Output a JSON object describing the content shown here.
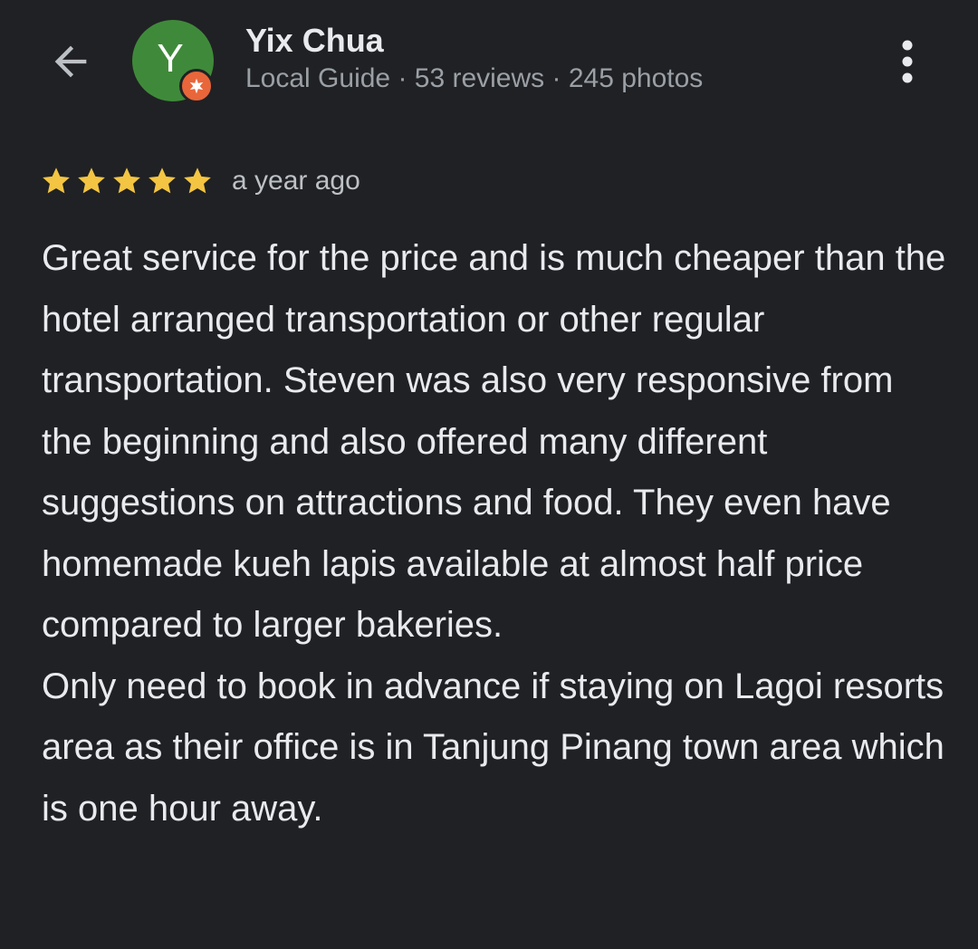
{
  "header": {
    "back_icon": "arrow-left-icon",
    "avatar_letter": "Y",
    "avatar_color": "#3f8a3a",
    "badge_icon": "local-guide-star-icon",
    "badge_color": "#e8663a",
    "user_name": "Yix Chua",
    "user_meta": "Local Guide · 53 reviews · 245 photos",
    "more_icon": "more-vert-icon"
  },
  "review": {
    "rating": 5,
    "max_rating": 5,
    "star_color": "#f4c542",
    "time_ago": "a year ago",
    "text": "Great service for the price and is much cheaper than the hotel arranged transportation or other regular transportation. Steven was also very responsive from the beginning and also offered many different suggestions on attractions and food. They even have homemade kueh lapis available at almost half price compared to larger bakeries.\nOnly need to book in advance if staying on Lagoi resorts area as their office is in Tanjung Pinang town area which is one hour away."
  }
}
